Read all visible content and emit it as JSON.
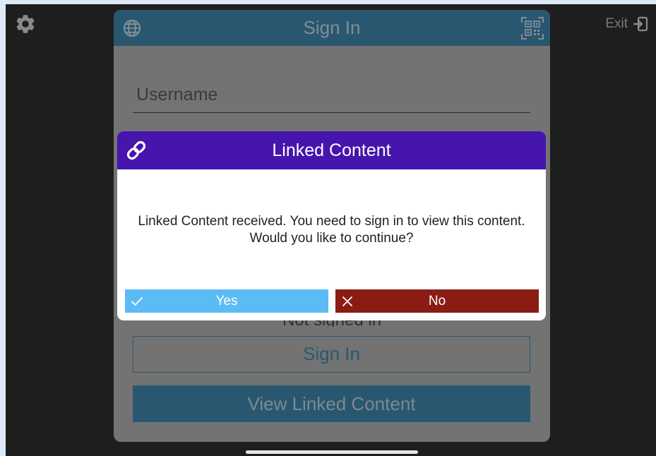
{
  "toolbar": {
    "settings_icon": "gear-icon",
    "exit_label": "Exit",
    "exit_icon": "exit-icon"
  },
  "signin": {
    "title": "Sign In",
    "language_icon": "globe-icon",
    "scan_icon": "qr-code-icon",
    "username_placeholder": "Username",
    "status_text": "Not signed in",
    "signin_button": "Sign In",
    "view_linked_button": "View Linked Content"
  },
  "dialog": {
    "icon": "link-icon",
    "title": "Linked Content",
    "message": "Linked Content received. You need to sign in to view this content. Would you like to continue?",
    "yes_label": "Yes",
    "yes_icon": "check-icon",
    "no_label": "No",
    "no_icon": "close-icon"
  },
  "colors": {
    "page_background": "#dde9f6",
    "app_background": "#1e1e1e",
    "card_background": "#737373",
    "header_blue": "#2a5770",
    "dialog_header": "#4615ae",
    "yes_button": "#5bbcf5",
    "no_button": "#8a1c14"
  }
}
